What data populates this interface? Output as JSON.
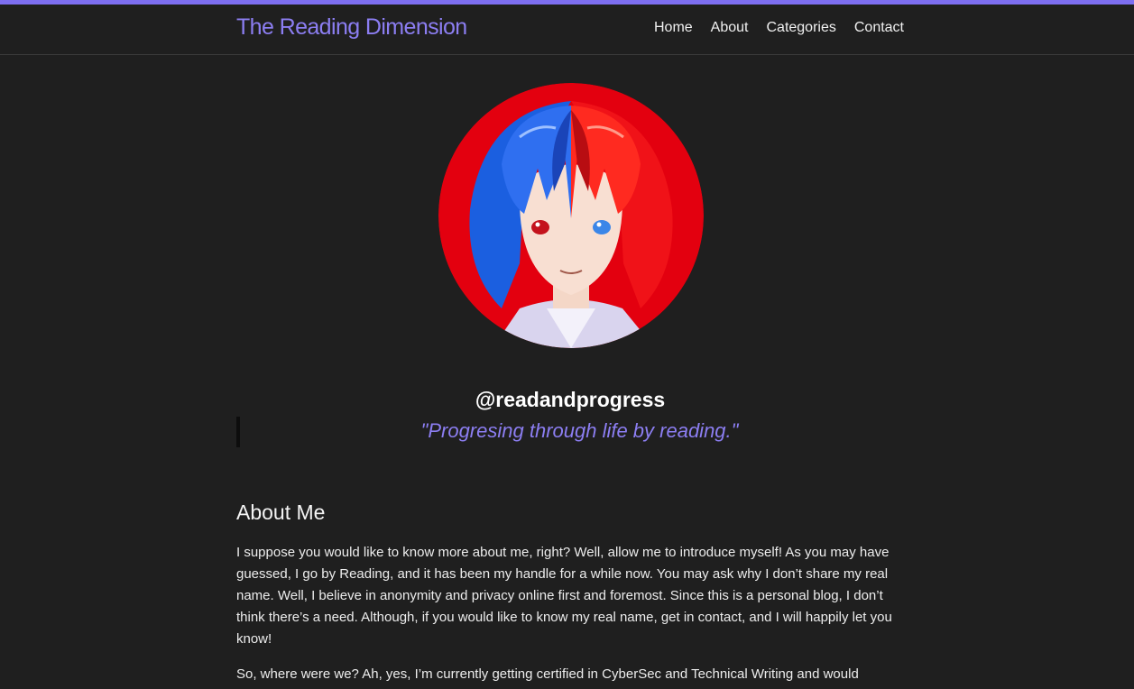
{
  "colors": {
    "accent": "#8c7ef2",
    "background": "#1f1f1f",
    "top_line": "#7d6ef0"
  },
  "header": {
    "site_title": "The Reading Dimension",
    "nav": [
      {
        "label": "Home"
      },
      {
        "label": "About"
      },
      {
        "label": "Categories"
      },
      {
        "label": "Contact"
      }
    ]
  },
  "profile": {
    "avatar": "anime-portrait-avatar",
    "handle": "@readandprogress",
    "tagline": "\"Progresing through life by reading.\""
  },
  "about": {
    "title": "About Me",
    "paragraphs": [
      "I suppose you would like to know more about me, right? Well, allow me to introduce myself! As you may have guessed, I go by Reading, and it has been my handle for a while now. You may ask why I don’t share my real name. Well, I believe in anonymity and privacy online first and foremost. Since this is a personal blog, I don’t think there’s a need. Although, if you would like to know my real name, get in contact, and I will happily let you know!",
      "So, where were we? Ah, yes, I’m currently getting certified in CyberSec and Technical Writing and would"
    ]
  }
}
